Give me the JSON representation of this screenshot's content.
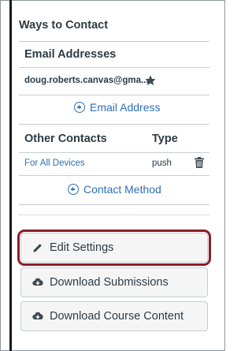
{
  "sidebar": {
    "title": "Ways to Contact",
    "email_section": {
      "header": "Email Addresses",
      "email": "doug.roberts.canvas@gma...",
      "add_label": "Email Address"
    },
    "contacts_section": {
      "header": "Other Contacts",
      "type_header": "Type",
      "rows": [
        {
          "name": "For All Devices",
          "type": "push"
        }
      ],
      "add_label": "Contact Method"
    },
    "buttons": {
      "edit_settings": "Edit Settings",
      "download_submissions": "Download Submissions",
      "download_course_content": "Download Course Content"
    }
  },
  "colors": {
    "link": "#2d6fb8",
    "text": "#2d3b45",
    "highlight": "#8c1d2a",
    "button_bg": "#f5f5f5"
  },
  "icons": [
    "star-icon",
    "plus-circle-icon",
    "trash-icon",
    "pencil-icon",
    "cloud-download-icon"
  ]
}
